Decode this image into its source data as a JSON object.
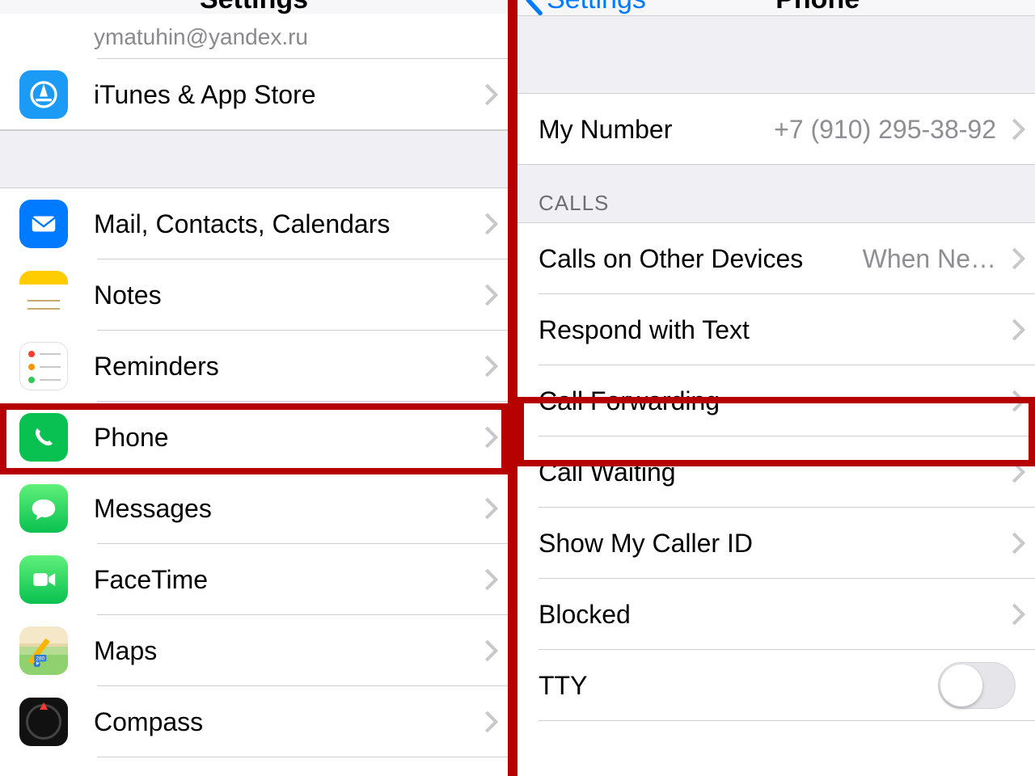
{
  "left": {
    "nav_title": "Settings",
    "email": "ymatuhin@yandex.ru",
    "items_top": [
      {
        "id": "itunes",
        "label": "iTunes & App Store"
      }
    ],
    "items": [
      {
        "id": "mail",
        "label": "Mail, Contacts, Calendars"
      },
      {
        "id": "notes",
        "label": "Notes"
      },
      {
        "id": "reminders",
        "label": "Reminders"
      },
      {
        "id": "phone",
        "label": "Phone"
      },
      {
        "id": "messages",
        "label": "Messages"
      },
      {
        "id": "facetime",
        "label": "FaceTime"
      },
      {
        "id": "maps",
        "label": "Maps"
      },
      {
        "id": "compass",
        "label": "Compass"
      }
    ]
  },
  "right": {
    "nav_back": "Settings",
    "nav_title": "Phone",
    "my_number_label": "My Number",
    "my_number_value": "+7 (910) 295-38-92",
    "section_calls": "CALLS",
    "calls": [
      {
        "id": "other-devices",
        "label": "Calls on Other Devices",
        "value": "When Ne…"
      },
      {
        "id": "respond-text",
        "label": "Respond with Text"
      },
      {
        "id": "call-forwarding",
        "label": "Call Forwarding"
      },
      {
        "id": "call-waiting",
        "label": "Call Waiting"
      },
      {
        "id": "caller-id",
        "label": "Show My Caller ID"
      },
      {
        "id": "blocked",
        "label": "Blocked"
      },
      {
        "id": "tty",
        "label": "TTY",
        "toggle": false
      }
    ]
  },
  "colors": {
    "highlight": "#b60000",
    "ios_blue": "#007aff"
  }
}
